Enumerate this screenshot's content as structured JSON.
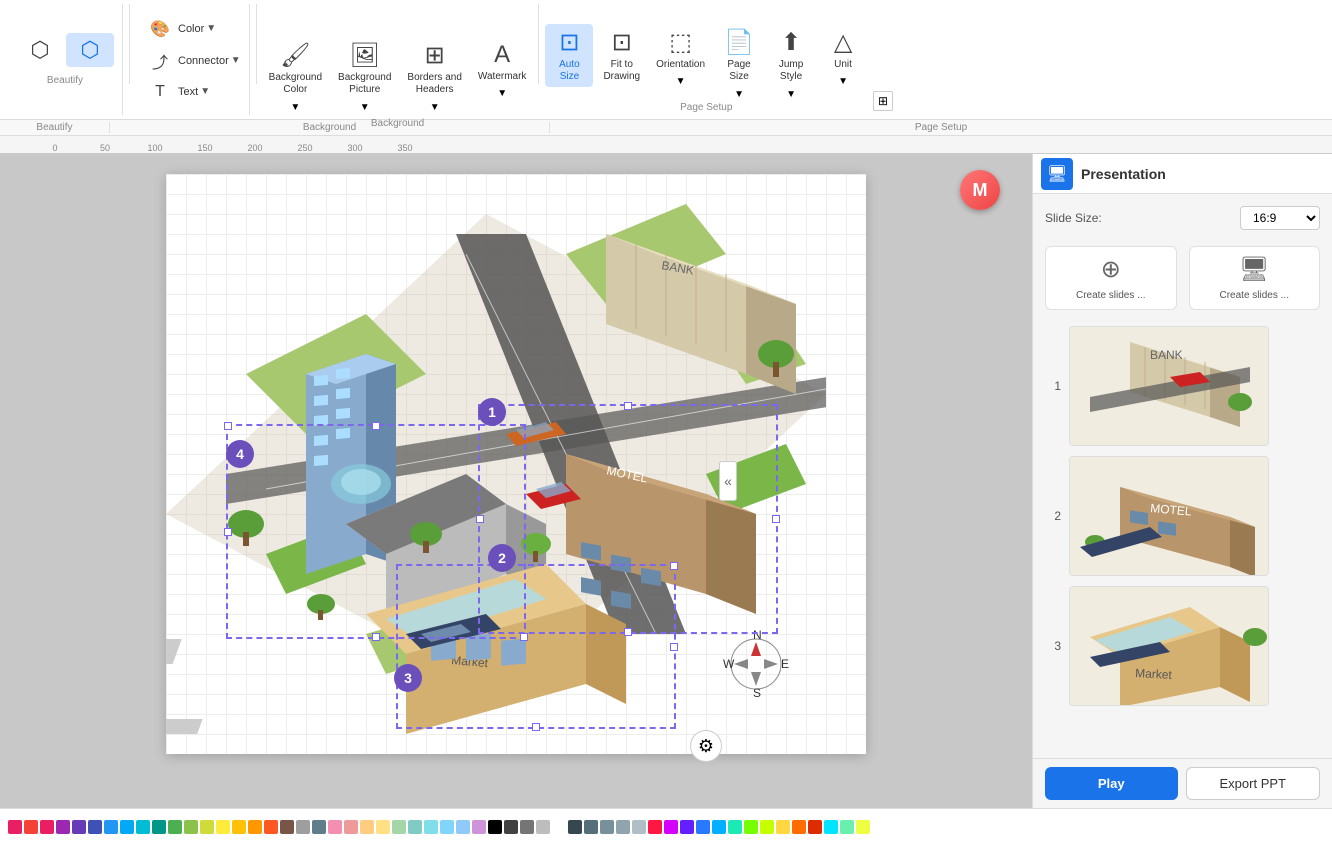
{
  "toolbar": {
    "beautify_label": "Beautify",
    "background_label": "Background",
    "page_setup_label": "Page Setup",
    "sections": {
      "beautify": {
        "items": [
          {
            "icon": "⬡",
            "label": ""
          },
          {
            "icon": "⬡",
            "label": ""
          }
        ]
      },
      "insert": {
        "color_label": "Color",
        "connector_label": "Connector",
        "text_label": "Text"
      },
      "background_color": {
        "label": "Background\nColor"
      },
      "background_picture": {
        "label": "Background\nPicture"
      },
      "borders_headers": {
        "label": "Borders and\nHeaders"
      },
      "watermark": {
        "label": "Watermark"
      },
      "auto_size": {
        "label": "Auto\nSize"
      },
      "fit_to_drawing": {
        "label": "Fit to\nDrawing"
      },
      "orientation": {
        "label": "Orientation"
      },
      "page_size": {
        "label": "Page\nSize"
      },
      "jump_style": {
        "label": "Jump\nStyle"
      },
      "unit": {
        "label": "Unit"
      }
    }
  },
  "panel": {
    "title": "Presentation",
    "slide_size_label": "Slide Size:",
    "slide_size_value": "16:9",
    "create_slides_from_shape": "Create slides ...",
    "create_slides_from_page": "Create slides ...",
    "play_label": "Play",
    "export_label": "Export PPT",
    "slides": [
      {
        "num": 1,
        "desc": "Bank building slide"
      },
      {
        "num": 2,
        "desc": "Motel building slide"
      },
      {
        "num": 3,
        "desc": "Market building slide"
      }
    ]
  },
  "canvas": {
    "numbers": [
      "1",
      "2",
      "3",
      "4"
    ]
  },
  "colors": [
    "#e91e63",
    "#f44336",
    "#e91e63",
    "#9c27b0",
    "#673ab7",
    "#3f51b5",
    "#2196f3",
    "#03a9f4",
    "#00bcd4",
    "#009688",
    "#4caf50",
    "#8bc34a",
    "#cddc39",
    "#ffeb3b",
    "#ffc107",
    "#ff9800",
    "#ff5722",
    "#795548",
    "#9e9e9e",
    "#607d8b",
    "#f48fb1",
    "#ef9a9a",
    "#ffcc80",
    "#ffe082",
    "#a5d6a7",
    "#80cbc4",
    "#80deea",
    "#81d4fa",
    "#90caf9",
    "#ce93d8",
    "#000000",
    "#424242",
    "#757575",
    "#bdbdbd",
    "#ffffff",
    "#37474f",
    "#546e7a",
    "#78909c",
    "#90a4ae",
    "#b0bec5",
    "#ff1744",
    "#d500f9",
    "#651fff",
    "#2979ff",
    "#00b0ff",
    "#1de9b6",
    "#76ff03",
    "#c6ff00",
    "#ffd740",
    "#ff6d00",
    "#dd2c00",
    "#00e5ff",
    "#69f0ae",
    "#eeff41"
  ]
}
